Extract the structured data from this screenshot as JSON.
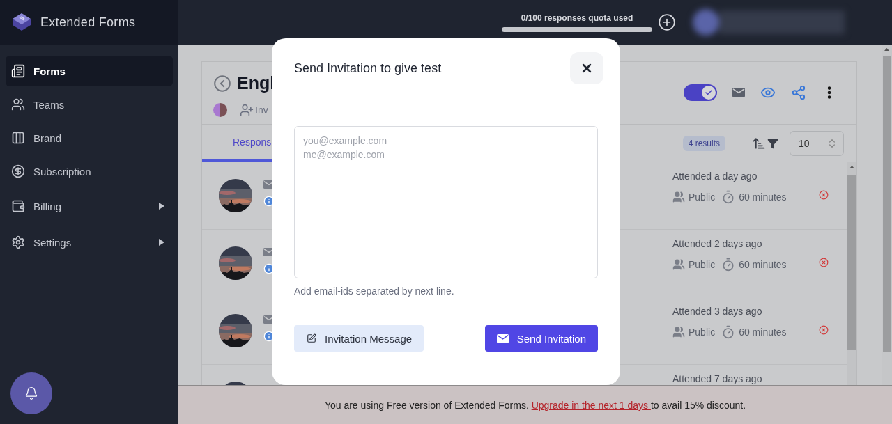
{
  "sidebar": {
    "brand": "Extended Forms",
    "items": [
      {
        "label": "Forms",
        "selected": true,
        "submenu": false
      },
      {
        "label": "Teams",
        "selected": false,
        "submenu": false
      },
      {
        "label": "Brand",
        "selected": false,
        "submenu": false
      },
      {
        "label": "Subscription",
        "selected": false,
        "submenu": false
      },
      {
        "label": "Billing",
        "selected": false,
        "submenu": true
      },
      {
        "label": "Settings",
        "selected": false,
        "submenu": true
      }
    ]
  },
  "header": {
    "quota": {
      "label": "0/100 responses quota used",
      "level": 0
    }
  },
  "form": {
    "title": "Engl",
    "invite_label": "Inv",
    "published": true,
    "tabs": [
      {
        "label": "Respons",
        "selected": true
      }
    ],
    "results": "4 results",
    "page_size": "10",
    "responses": [
      {
        "attended": "Attended a day ago",
        "visibility": "Public",
        "duration": "60 minutes"
      },
      {
        "attended": "Attended 2 days ago",
        "visibility": "Public",
        "duration": "60 minutes"
      },
      {
        "attended": "Attended 3 days ago",
        "visibility": "Public",
        "duration": "60 minutes"
      },
      {
        "attended": "Attended 7 days ago"
      }
    ]
  },
  "dialog": {
    "title": "Send Invitation to give test",
    "emails": {
      "placeholder": "you@example.com\nme@example.com"
    },
    "hint": "Add email-ids separated by next line.",
    "buttons": [
      {
        "label": "Invitation Message",
        "kind": "secondary"
      },
      {
        "label": "Send Invitation",
        "kind": "primary"
      }
    ]
  },
  "banner": {
    "text": "You are using Free version of Extended Forms. ",
    "link": "Upgrade in the next 1 days ",
    "suffix": "to avail 15% discount."
  }
}
